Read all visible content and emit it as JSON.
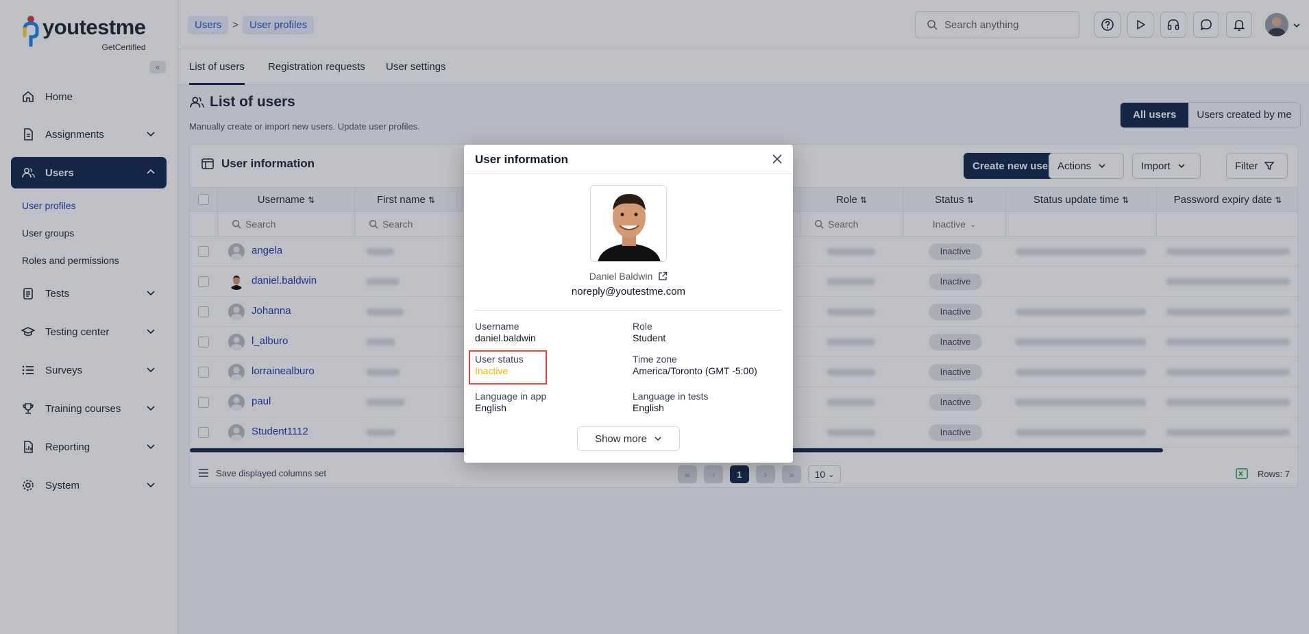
{
  "app": {
    "logo_text": "youtestme",
    "logo_sub": "GetCertified"
  },
  "sidebar": {
    "items": [
      {
        "label": "Home",
        "icon": "home-icon"
      },
      {
        "label": "Assignments",
        "icon": "document-icon"
      },
      {
        "label": "Users",
        "icon": "users-icon"
      },
      {
        "label": "Tests",
        "icon": "clipboard-icon"
      },
      {
        "label": "Testing center",
        "icon": "graduation-cap-icon"
      },
      {
        "label": "Surveys",
        "icon": "list-icon"
      },
      {
        "label": "Training courses",
        "icon": "trophy-icon"
      },
      {
        "label": "Reporting",
        "icon": "report-icon"
      },
      {
        "label": "System",
        "icon": "gear-icon"
      }
    ],
    "users_sub": [
      "User profiles",
      "User groups",
      "Roles and permissions"
    ]
  },
  "breadcrumb": {
    "first": "Users",
    "sep": ">",
    "second": "User profiles"
  },
  "search": {
    "placeholder": "Search anything"
  },
  "tabs": [
    "List of users",
    "Registration requests",
    "User settings"
  ],
  "page": {
    "title": "List of users",
    "description": "Manually create or import new users. Update user profiles.",
    "segments": [
      "All users",
      "Users created by me"
    ]
  },
  "card": {
    "title": "User information",
    "buttons": {
      "create": "Create new user",
      "actions": "Actions",
      "import": "Import",
      "filter": "Filter"
    },
    "columns": [
      "Username",
      "First name",
      "Role",
      "Status",
      "Status update time",
      "Password expiry date"
    ],
    "filter": {
      "search": "Search",
      "status": "Inactive"
    },
    "rows": [
      {
        "username": "angela",
        "status": "Inactive"
      },
      {
        "username": "daniel.baldwin",
        "status": "Inactive"
      },
      {
        "username": "Johanna",
        "status": "Inactive"
      },
      {
        "username": "l_alburo",
        "status": "Inactive"
      },
      {
        "username": "lorrainealburo",
        "status": "Inactive"
      },
      {
        "username": "paul",
        "status": "Inactive"
      },
      {
        "username": "Student1112",
        "status": "Inactive"
      }
    ],
    "footer": {
      "save": "Save displayed columns set",
      "page": "1",
      "page_size": "10",
      "rows": "Rows: 7"
    }
  },
  "modal": {
    "title": "User information",
    "name": "Daniel Baldwin",
    "email": "noreply@youtestme.com",
    "fields": {
      "username_label": "Username",
      "username": "daniel.baldwin",
      "role_label": "Role",
      "role": "Student",
      "status_label": "User status",
      "status": "Inactive",
      "tz_label": "Time zone",
      "tz": "America/Toronto (GMT -5:00)",
      "lang_app_label": "Language in app",
      "lang_app": "English",
      "lang_tests_label": "Language in tests",
      "lang_tests": "English"
    },
    "show_more": "Show more"
  },
  "colors": {
    "primary": "#172a4f",
    "link": "#1e40af",
    "warning": "#f0b400",
    "highlight": "#e0463b"
  }
}
